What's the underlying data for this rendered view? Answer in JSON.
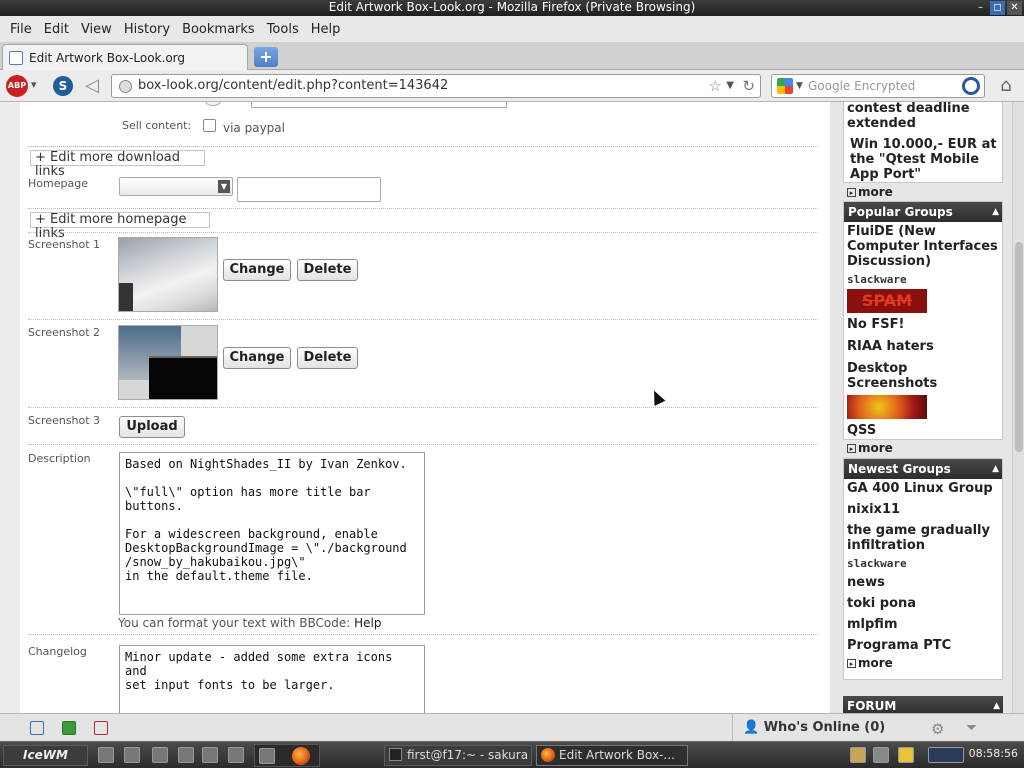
{
  "window": {
    "title": "Edit  Artwork Box-Look.org - Mozilla Firefox (Private Browsing)"
  },
  "menu": [
    "File",
    "Edit",
    "View",
    "History",
    "Bookmarks",
    "Tools",
    "Help"
  ],
  "tab": {
    "title": "Edit  Artwork Box-Look.org",
    "new_tab_label": "+"
  },
  "nav": {
    "abp_label": "ABP",
    "url": "box-look.org/content/edit.php?content=143642",
    "search_placeholder": "Google Encrypted"
  },
  "form": {
    "sell_label": "Sell content:",
    "sell_option": "via paypal",
    "edit_download_links": "Edit more download links",
    "homepage_label": "Homepage",
    "edit_homepage_links": "Edit more homepage links",
    "screenshot1_label": "Screenshot 1",
    "screenshot2_label": "Screenshot 2",
    "screenshot3_label": "Screenshot 3",
    "change_label": "Change",
    "delete_label": "Delete",
    "upload_label": "Upload",
    "description_label": "Description",
    "description_text": "Based on NightShades_II by Ivan Zenkov.\n\n\\\"full\\\" option has more title bar\nbuttons.\n\nFor a widescreen background, enable\nDesktopBackgroundImage = \\\"./background\n/snow_by_hakubaikou.jpg\\\"\nin the default.theme file.",
    "bbcode_text": "You can format your text with BBCode:",
    "bbcode_help": "Help",
    "changelog_label": "Changelog",
    "changelog_text": "Minor update - added some extra icons and\nset input fonts to be larger."
  },
  "sidebar": {
    "news_tail": [
      "contest deadline extended",
      "Win 10.000,- EUR at the \"Qtest Mobile App Port\""
    ],
    "more": "more",
    "popular_title": "Popular Groups",
    "popular": [
      "FluiDE (New Computer Interfaces Discussion)",
      "slackware",
      "SPAM",
      "No FSF!",
      "RIAA haters",
      "Desktop Screenshots",
      "QSS"
    ],
    "newest_title": "Newest Groups",
    "newest": [
      "GA 400 Linux Group",
      "nixix11",
      "the game gradually infiltration",
      "slackware",
      "news",
      "toki pona",
      "mlpfim",
      "Programa PTC"
    ],
    "forum_title": "FORUM"
  },
  "status": {
    "whos_online": "Who's Online (0)"
  },
  "taskbar": {
    "start": "IceWM",
    "task1": "first@f17:~ - sakura",
    "task2": "Edit  Artwork Box-...",
    "clock": "08:58:56"
  }
}
